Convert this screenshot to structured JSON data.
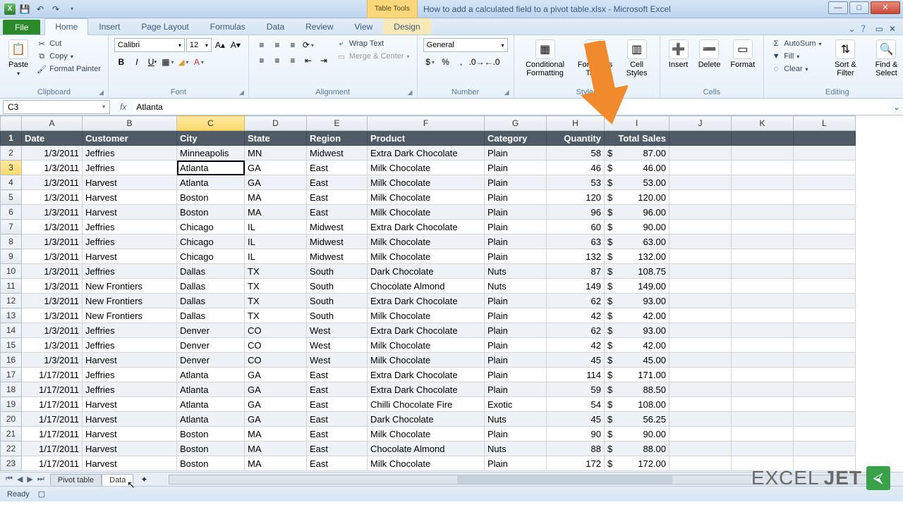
{
  "window": {
    "contextual_tab_group": "Table Tools",
    "title": "How to add a calculated field to a pivot table.xlsx - Microsoft Excel"
  },
  "tabs": {
    "file": "File",
    "home": "Home",
    "insert": "Insert",
    "page_layout": "Page Layout",
    "formulas": "Formulas",
    "data": "Data",
    "review": "Review",
    "view": "View",
    "design": "Design"
  },
  "ribbon": {
    "clipboard": {
      "label": "Clipboard",
      "paste": "Paste",
      "cut": "Cut",
      "copy": "Copy",
      "painter": "Format Painter"
    },
    "font": {
      "label": "Font",
      "name": "Calibri",
      "size": "12"
    },
    "alignment": {
      "label": "Alignment",
      "wrap": "Wrap Text",
      "merge": "Merge & Center"
    },
    "number": {
      "label": "Number",
      "format": "General"
    },
    "styles": {
      "label": "Styles",
      "cond": "Conditional Formatting",
      "table": "Format as Table",
      "cell": "Cell Styles"
    },
    "cells": {
      "label": "Cells",
      "insert": "Insert",
      "delete": "Delete",
      "format": "Format"
    },
    "editing": {
      "label": "Editing",
      "autosum": "AutoSum",
      "fill": "Fill",
      "clear": "Clear",
      "sort": "Sort & Filter",
      "find": "Find & Select"
    }
  },
  "formula_bar": {
    "name_box": "C3",
    "formula": "Atlanta"
  },
  "columns": [
    "A",
    "B",
    "C",
    "D",
    "E",
    "F",
    "G",
    "H",
    "I",
    "J",
    "K",
    "L"
  ],
  "headers": {
    "A": "Date",
    "B": "Customer",
    "C": "City",
    "D": "State",
    "E": "Region",
    "F": "Product",
    "G": "Category",
    "H": "Quantity",
    "I": "Total Sales"
  },
  "selected_cell": "C3",
  "rows": [
    {
      "n": 2,
      "A": "1/3/2011",
      "B": "Jeffries",
      "C": "Minneapolis",
      "D": "MN",
      "E": "Midwest",
      "F": "Extra Dark Chocolate",
      "G": "Plain",
      "H": "58",
      "I": "87.00"
    },
    {
      "n": 3,
      "A": "1/3/2011",
      "B": "Jeffries",
      "C": "Atlanta",
      "D": "GA",
      "E": "East",
      "F": "Milk Chocolate",
      "G": "Plain",
      "H": "46",
      "I": "46.00"
    },
    {
      "n": 4,
      "A": "1/3/2011",
      "B": "Harvest",
      "C": "Atlanta",
      "D": "GA",
      "E": "East",
      "F": "Milk Chocolate",
      "G": "Plain",
      "H": "53",
      "I": "53.00"
    },
    {
      "n": 5,
      "A": "1/3/2011",
      "B": "Harvest",
      "C": "Boston",
      "D": "MA",
      "E": "East",
      "F": "Milk Chocolate",
      "G": "Plain",
      "H": "120",
      "I": "120.00"
    },
    {
      "n": 6,
      "A": "1/3/2011",
      "B": "Harvest",
      "C": "Boston",
      "D": "MA",
      "E": "East",
      "F": "Milk Chocolate",
      "G": "Plain",
      "H": "96",
      "I": "96.00"
    },
    {
      "n": 7,
      "A": "1/3/2011",
      "B": "Jeffries",
      "C": "Chicago",
      "D": "IL",
      "E": "Midwest",
      "F": "Extra Dark Chocolate",
      "G": "Plain",
      "H": "60",
      "I": "90.00"
    },
    {
      "n": 8,
      "A": "1/3/2011",
      "B": "Jeffries",
      "C": "Chicago",
      "D": "IL",
      "E": "Midwest",
      "F": "Milk Chocolate",
      "G": "Plain",
      "H": "63",
      "I": "63.00"
    },
    {
      "n": 9,
      "A": "1/3/2011",
      "B": "Harvest",
      "C": "Chicago",
      "D": "IL",
      "E": "Midwest",
      "F": "Milk Chocolate",
      "G": "Plain",
      "H": "132",
      "I": "132.00"
    },
    {
      "n": 10,
      "A": "1/3/2011",
      "B": "Jeffries",
      "C": "Dallas",
      "D": "TX",
      "E": "South",
      "F": "Dark Chocolate",
      "G": "Nuts",
      "H": "87",
      "I": "108.75"
    },
    {
      "n": 11,
      "A": "1/3/2011",
      "B": "New Frontiers",
      "C": "Dallas",
      "D": "TX",
      "E": "South",
      "F": "Chocolate Almond",
      "G": "Nuts",
      "H": "149",
      "I": "149.00"
    },
    {
      "n": 12,
      "A": "1/3/2011",
      "B": "New Frontiers",
      "C": "Dallas",
      "D": "TX",
      "E": "South",
      "F": "Extra Dark Chocolate",
      "G": "Plain",
      "H": "62",
      "I": "93.00"
    },
    {
      "n": 13,
      "A": "1/3/2011",
      "B": "New Frontiers",
      "C": "Dallas",
      "D": "TX",
      "E": "South",
      "F": "Milk Chocolate",
      "G": "Plain",
      "H": "42",
      "I": "42.00"
    },
    {
      "n": 14,
      "A": "1/3/2011",
      "B": "Jeffries",
      "C": "Denver",
      "D": "CO",
      "E": "West",
      "F": "Extra Dark Chocolate",
      "G": "Plain",
      "H": "62",
      "I": "93.00"
    },
    {
      "n": 15,
      "A": "1/3/2011",
      "B": "Jeffries",
      "C": "Denver",
      "D": "CO",
      "E": "West",
      "F": "Milk Chocolate",
      "G": "Plain",
      "H": "42",
      "I": "42.00"
    },
    {
      "n": 16,
      "A": "1/3/2011",
      "B": "Harvest",
      "C": "Denver",
      "D": "CO",
      "E": "West",
      "F": "Milk Chocolate",
      "G": "Plain",
      "H": "45",
      "I": "45.00"
    },
    {
      "n": 17,
      "A": "1/17/2011",
      "B": "Jeffries",
      "C": "Atlanta",
      "D": "GA",
      "E": "East",
      "F": "Extra Dark Chocolate",
      "G": "Plain",
      "H": "114",
      "I": "171.00"
    },
    {
      "n": 18,
      "A": "1/17/2011",
      "B": "Jeffries",
      "C": "Atlanta",
      "D": "GA",
      "E": "East",
      "F": "Extra Dark Chocolate",
      "G": "Plain",
      "H": "59",
      "I": "88.50"
    },
    {
      "n": 19,
      "A": "1/17/2011",
      "B": "Harvest",
      "C": "Atlanta",
      "D": "GA",
      "E": "East",
      "F": "Chilli Chocolate Fire",
      "G": "Exotic",
      "H": "54",
      "I": "108.00"
    },
    {
      "n": 20,
      "A": "1/17/2011",
      "B": "Harvest",
      "C": "Atlanta",
      "D": "GA",
      "E": "East",
      "F": "Dark Chocolate",
      "G": "Nuts",
      "H": "45",
      "I": "56.25"
    },
    {
      "n": 21,
      "A": "1/17/2011",
      "B": "Harvest",
      "C": "Boston",
      "D": "MA",
      "E": "East",
      "F": "Milk Chocolate",
      "G": "Plain",
      "H": "90",
      "I": "90.00"
    },
    {
      "n": 22,
      "A": "1/17/2011",
      "B": "Harvest",
      "C": "Boston",
      "D": "MA",
      "E": "East",
      "F": "Chocolate Almond",
      "G": "Nuts",
      "H": "88",
      "I": "88.00"
    },
    {
      "n": 23,
      "A": "1/17/2011",
      "B": "Harvest",
      "C": "Boston",
      "D": "MA",
      "E": "East",
      "F": "Milk Chocolate",
      "G": "Plain",
      "H": "172",
      "I": "172.00"
    }
  ],
  "sheets": {
    "pivot": "Pivot table",
    "data": "Data"
  },
  "status": {
    "ready": "Ready"
  },
  "logo": {
    "a": "EXCEL",
    "b": "JET"
  }
}
